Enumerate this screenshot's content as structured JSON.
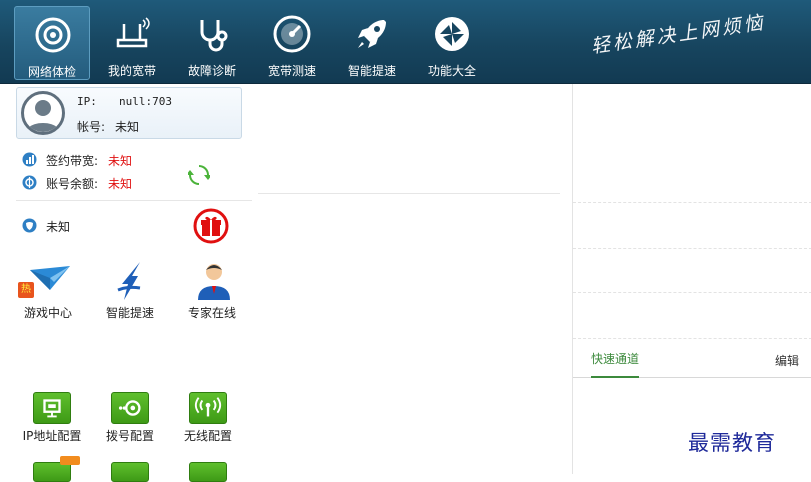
{
  "toolbar": {
    "items": [
      {
        "label": "网络体检",
        "icon": "target-icon",
        "active": true
      },
      {
        "label": "我的宽带",
        "icon": "router-icon",
        "active": false
      },
      {
        "label": "故障诊断",
        "icon": "stethoscope-icon",
        "active": false
      },
      {
        "label": "宽带测速",
        "icon": "speedometer-icon",
        "active": false
      },
      {
        "label": "智能提速",
        "icon": "rocket-icon",
        "active": false
      },
      {
        "label": "功能大全",
        "icon": "app-grid-icon",
        "active": false
      }
    ],
    "slogan": "轻松解决上网烦恼"
  },
  "user": {
    "ip_label": "IP:",
    "ip_value": "null:703",
    "account_label": "帐号:",
    "account_value": "未知"
  },
  "info": {
    "bandwidth_label": "签约带宽:",
    "bandwidth_value": "未知",
    "balance_label": "账号余额:",
    "balance_value": "未知",
    "status_value": "未知"
  },
  "features": [
    {
      "label": "游戏中心",
      "icon": "paper-plane-icon",
      "badge": "热"
    },
    {
      "label": "智能提速",
      "icon": "speed-arrow-icon"
    },
    {
      "label": "专家在线",
      "icon": "expert-person-icon"
    }
  ],
  "tools": [
    {
      "label": "IP地址配置",
      "icon": "monitor-icon"
    },
    {
      "label": "拨号配置",
      "icon": "dialup-icon"
    },
    {
      "label": "无线配置",
      "icon": "wifi-icon"
    }
  ],
  "right_panel": {
    "tab_quick": "快速通道",
    "tab_edit": "编辑"
  },
  "watermark": "最需教育",
  "colors": {
    "toolbar_bg": "#17455f",
    "accent_green": "#3c8a3c",
    "alert_red": "#e01010",
    "tool_green": "#4aa81f"
  }
}
